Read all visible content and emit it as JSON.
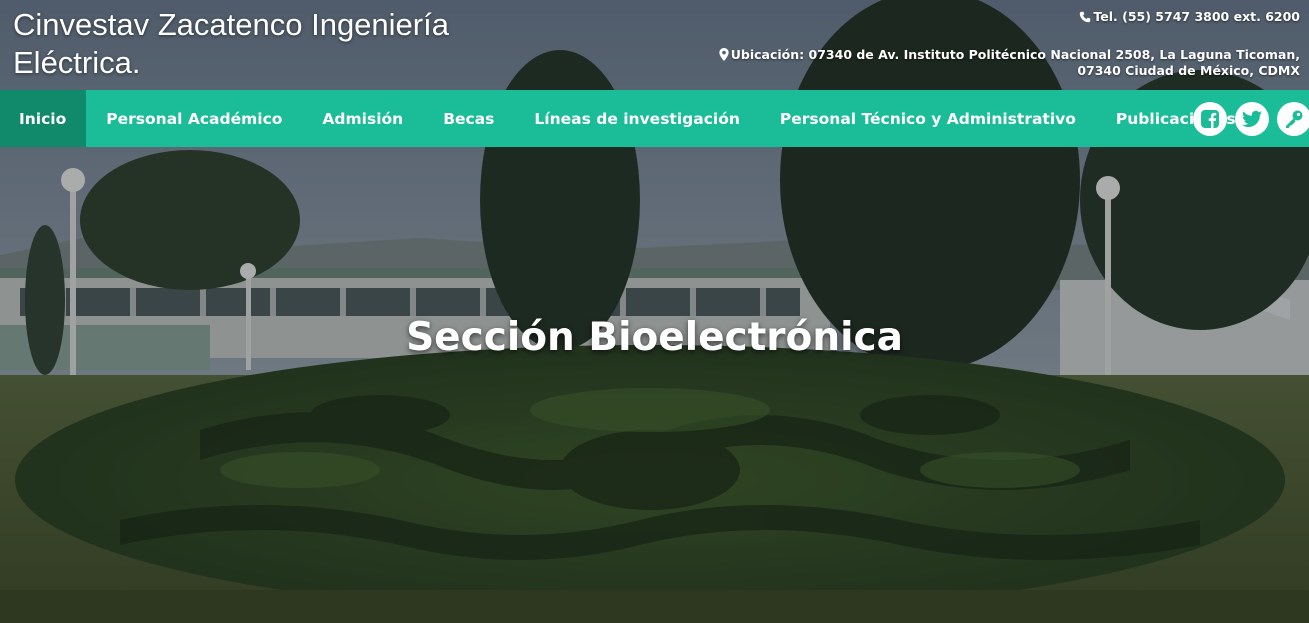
{
  "header": {
    "site_title": "Cinvestav Zacatenco Ingeniería Eléctrica.",
    "phone": "Tel. (55) 5747 3800 ext. 6200",
    "address_line1": "Ubicación: 07340 de Av. Instituto Politécnico Nacional 2508, La Laguna Ticoman,",
    "address_line2": "07340 Ciudad de México, CDMX"
  },
  "nav": {
    "items": [
      {
        "label": "Inicio"
      },
      {
        "label": "Personal Académico"
      },
      {
        "label": "Admisión"
      },
      {
        "label": "Becas"
      },
      {
        "label": "Líneas de investigación"
      },
      {
        "label": "Personal Técnico y Administrativo"
      },
      {
        "label": "Publicaciones"
      }
    ],
    "active_index": 0,
    "social_icons": [
      "facebook-icon",
      "twitter-icon",
      "key-icon"
    ]
  },
  "hero": {
    "title": "Sección Bioelectrónica"
  },
  "colors": {
    "nav_bg": "#1bbd98",
    "nav_active_bg": "#118a6c",
    "icon_color": "#1bbd98"
  }
}
